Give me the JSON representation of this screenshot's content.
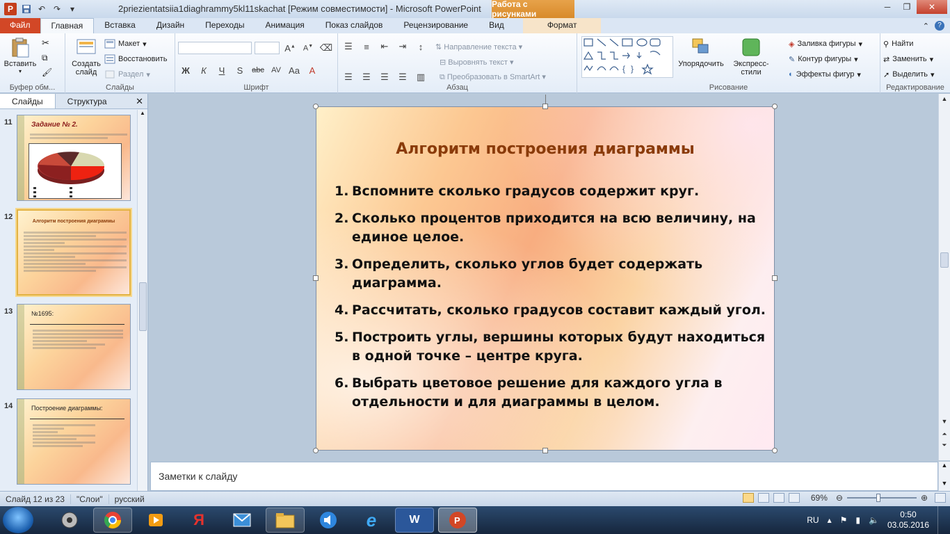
{
  "window": {
    "title": "2priezientatsiia1diaghrammy5kl11skachat [Режим совместимости]  -  Microsoft PowerPoint",
    "context_tab_header": "Работа с рисунками"
  },
  "tabs": [
    {
      "label": "Файл"
    },
    {
      "label": "Главная"
    },
    {
      "label": "Вставка"
    },
    {
      "label": "Дизайн"
    },
    {
      "label": "Переходы"
    },
    {
      "label": "Анимация"
    },
    {
      "label": "Показ слайдов"
    },
    {
      "label": "Рецензирование"
    },
    {
      "label": "Вид"
    },
    {
      "label": "Формат"
    }
  ],
  "ribbon": {
    "clipboard": {
      "paste": "Вставить",
      "label": "Буфер обм..."
    },
    "slides": {
      "new_slide": "Создать слайд",
      "layout": "Макет",
      "reset": "Восстановить",
      "section": "Раздел",
      "label": "Слайды"
    },
    "font": {
      "label": "Шрифт",
      "font_name": "",
      "font_size": ""
    },
    "paragraph": {
      "text_direction": "Направление текста",
      "align_text": "Выровнять текст",
      "convert_smartart": "Преобразовать в SmartArt",
      "label": "Абзац"
    },
    "drawing": {
      "arrange": "Упорядочить",
      "quick_styles": "Экспресс-стили",
      "shape_fill": "Заливка фигуры",
      "shape_outline": "Контур фигуры",
      "shape_effects": "Эффекты фигур",
      "label": "Рисование"
    },
    "editing": {
      "find": "Найти",
      "replace": "Заменить",
      "select": "Выделить",
      "label": "Редактирование"
    }
  },
  "left_pane": {
    "tab_slides": "Слайды",
    "tab_outline": "Структура",
    "thumbnails": [
      {
        "number": "11",
        "title": "Задание № 2."
      },
      {
        "number": "12",
        "title": "Алгоритм построения диаграммы"
      },
      {
        "number": "13",
        "title": "№1695:"
      },
      {
        "number": "14",
        "title": "Построение диаграммы:"
      }
    ]
  },
  "slide": {
    "title": "Алгоритм построения диаграммы",
    "items": [
      {
        "num": "1.",
        "text": "Вспомните сколько градусов содержит круг."
      },
      {
        "num": "2.",
        "text": "Сколько процентов приходится на всю величину, на единое целое."
      },
      {
        "num": "3.",
        "text": "Определить, сколько углов будет содержать диаграмма."
      },
      {
        "num": "4.",
        "text": "Рассчитать, сколько градусов составит каждый угол."
      },
      {
        "num": "5.",
        "text": "Построить углы, вершины которых будут находиться в одной точке – центре круга."
      },
      {
        "num": "6.",
        "text": "Выбрать цветовое решение для каждого угла в отдельности и для диаграммы в целом."
      }
    ]
  },
  "notes": {
    "placeholder": "Заметки к слайду"
  },
  "status": {
    "slide_counter": "Слайд 12 из 23",
    "theme": "\"Слои\"",
    "language": "русский",
    "zoom": "69%",
    "zoom_fraction": 0.45
  },
  "taskbar": {
    "lang": "RU",
    "time": "0:50",
    "date": "03.05.2016"
  },
  "colors": {
    "accent_file": "#d24726",
    "slide_title": "#8a3b0a",
    "context": "#e7a24a"
  }
}
